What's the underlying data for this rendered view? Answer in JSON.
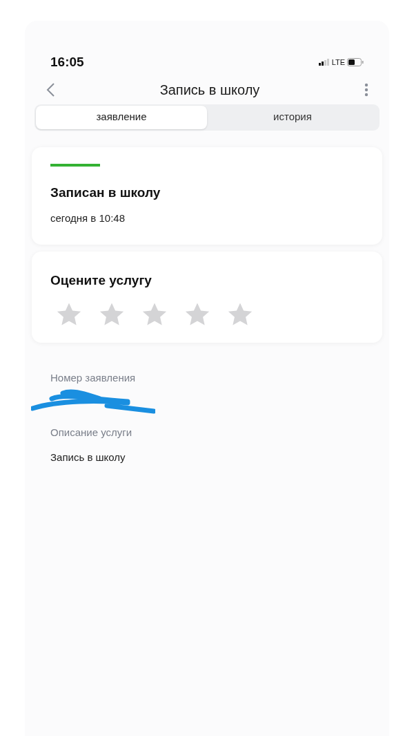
{
  "status_bar": {
    "time": "16:05",
    "network": "LTE"
  },
  "header": {
    "title": "Запись в школу"
  },
  "tabs": [
    {
      "label": "заявление",
      "selected": true
    },
    {
      "label": "история",
      "selected": false
    }
  ],
  "status_card": {
    "title": "Записан в школу",
    "time": "сегодня в 10:48"
  },
  "rating_card": {
    "title": "Оцените услугу",
    "stars": 0
  },
  "details": [
    {
      "label": "Номер заявления",
      "redacted": true
    },
    {
      "label": "Описание услуги",
      "value": "Запись в школу"
    }
  ]
}
